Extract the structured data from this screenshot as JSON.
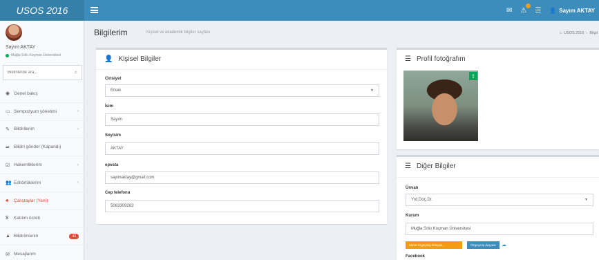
{
  "app": {
    "logo": "USOS 2016"
  },
  "topbar": {
    "user_name": "Sayım AKTAY"
  },
  "sidebar": {
    "user_name": "Sayım AKTAY",
    "user_status": "Muğla Sıtkı Koçman Üniversitesi",
    "search_placeholder": "Bildirilerde ara...",
    "items": [
      {
        "label": "Genel bakış",
        "icon": "dashboard-icon"
      },
      {
        "label": "Sempozyum yönetimi",
        "icon": "monitor-icon"
      },
      {
        "label": "Bildirilerim",
        "icon": "edit-icon"
      },
      {
        "label": "Bildiri gönder (Kapandı)",
        "icon": "share-icon"
      },
      {
        "label": "Hakemliklerim",
        "icon": "check-square-icon"
      },
      {
        "label": "Editörlüklerim",
        "icon": "users-icon"
      },
      {
        "label": "Çalıştaylar (Yeni)",
        "icon": "group-icon"
      },
      {
        "label": "Katılım ücreti",
        "icon": "money-icon"
      },
      {
        "label": "Bildirimlerim",
        "icon": "warning-icon",
        "count": "43"
      },
      {
        "label": "Mesajlarım",
        "icon": "mail-icon"
      }
    ]
  },
  "header": {
    "title": "Bilgilerim",
    "subtitle": "Kişisel ve akademik bilgiler sayfası",
    "breadcrumb_home": "USOS 2016",
    "breadcrumb_current": "Bilgil"
  },
  "personal": {
    "title": "Kişisel Bilgiler",
    "gender_label": "Cinsiyet",
    "gender_value": "Erkek",
    "name_label": "İsim",
    "name_value": "Sayım",
    "surname_label": "Soyisim",
    "surname_value": "AKTAY",
    "email_label": "eposta",
    "email_value": "sayimaktay@gmail.com",
    "phone_label": "Cep telefonu",
    "phone_value": "5063309263"
  },
  "photo_box": {
    "title": "Profil fotoğrafım"
  },
  "other": {
    "title": "Diğer Bilgiler",
    "title_label": "Ünvan",
    "title_value": "Yrd.Doç.Dr.",
    "institution_label": "Kurum",
    "institution_value": "Muğla Sıtkı Koçman Üniversitesi",
    "btn_orange": "Varsa özgeçmiş dosyası...",
    "btn_blue": "Özgeçmiş dosyası",
    "facebook_label": "Facebook"
  },
  "colors": {
    "primary": "#3c8dbc",
    "logo_bg": "#367fa9",
    "green": "#00a65a",
    "red": "#dd4b39",
    "orange": "#f39c12"
  }
}
